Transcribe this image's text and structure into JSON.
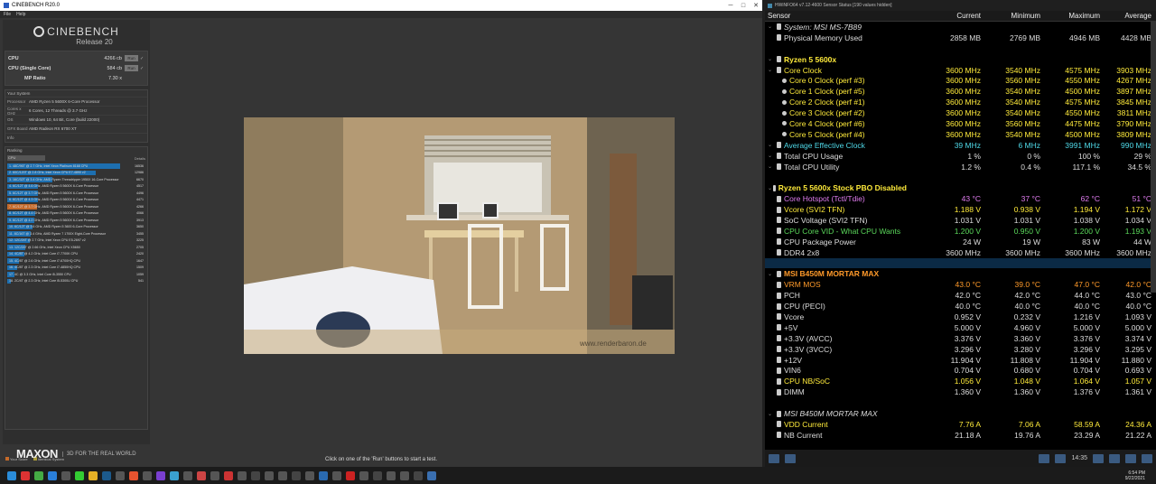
{
  "cinebench": {
    "window_title": "CINEBENCH R20.0",
    "menu": [
      "File",
      "Help"
    ],
    "logo_name": "CINEBENCH",
    "logo_release": "Release 20",
    "scores": [
      {
        "label": "CPU",
        "value": "4266 cb",
        "run": "Run"
      },
      {
        "label": "CPU (Single Core)",
        "value": "584 cb",
        "run": "Run"
      },
      {
        "label": "MP Ratio",
        "value": "7.30 x"
      }
    ],
    "system_title": "Your System",
    "system": [
      {
        "key": "Processor",
        "value": "AMD Ryzen 5 5600X 6-Core Processor"
      },
      {
        "key": "Cores x GHz",
        "value": "6 Cores, 12 Threads @ 3.7 GHz"
      },
      {
        "key": "OS",
        "value": "Windows 10, 64 Bit, Core (build 22000)"
      },
      {
        "key": "GFX Board",
        "value": "AMD Radeon RX 6700 XT"
      },
      {
        "key": "Info",
        "value": ""
      }
    ],
    "ranking_title": "Ranking",
    "ranking_select": "CPU",
    "ranking_details": "Details",
    "ranking": [
      {
        "text": "1. 48C/96T @ 2.7 GHz, Intel Xeon Platinum 8168 CPU",
        "score": "16536",
        "pct": 100,
        "own": false
      },
      {
        "text": "2. 60C/120T @ 2.8 GHz, Intel Xeon CPU E7-4890 v2",
        "score": "12986",
        "pct": 78,
        "own": false
      },
      {
        "text": "3. 16C/32T @ 3.4 GHz, AMD Ryzen Threadripper 1950X 16-Core Processor",
        "score": "6670",
        "pct": 40,
        "own": false
      },
      {
        "text": "4. 6C/12T @ 4.6 GHz, AMD Ryzen 5 5600X 6-Core Processor",
        "score": "4517",
        "pct": 27,
        "own": false
      },
      {
        "text": "5. 6C/12T @ 3.7 GHz, AMD Ryzen 5 5600X 6-Core Processor",
        "score": "4496",
        "pct": 27,
        "own": false
      },
      {
        "text": "6. 6C/12T @ 4.3 GHz, AMD Ryzen 5 5600X 6-Core Processor",
        "score": "4471",
        "pct": 27,
        "own": false
      },
      {
        "text": "7. 6C/12T @ 3.7 GHz, AMD Ryzen 5 5600X 6-Core Processor",
        "score": "4266",
        "pct": 26,
        "own": true
      },
      {
        "text": "8. 6C/12T @ 4.4 GHz, AMD Ryzen 5 5600X 6-Core Processor",
        "score": "4066",
        "pct": 25,
        "own": false
      },
      {
        "text": "9. 6C/12T @ 4.2 GHz, AMD Ryzen 5 5600X 6-Core Processor",
        "score": "3913",
        "pct": 24,
        "own": false
      },
      {
        "text": "10. 6C/12T @ 3.6 GHz, AMD Ryzen 5 3600 6-Core Processor",
        "score": "3650",
        "pct": 22,
        "own": false
      },
      {
        "text": "11. 8C/16T @ 3.4 GHz, AMD Ryzen 7 1700X Eight-Core Processor",
        "score": "3455",
        "pct": 21,
        "own": false
      },
      {
        "text": "12. 12C/24T @ 2.7 GHz, Intel Xeon CPU E5-2697 v2",
        "score": "3225",
        "pct": 20,
        "own": false
      },
      {
        "text": "13. 12C/24T @ 2.66 GHz, Intel Xeon CPU X5650",
        "score": "2705",
        "pct": 16,
        "own": false
      },
      {
        "text": "14. 4C/8T @ 4.2 GHz, Intel Core i7-7700K CPU",
        "score": "2420",
        "pct": 15,
        "own": false
      },
      {
        "text": "15. 4C/8T @ 2.6 GHz, Intel Core i7-6700HQ CPU",
        "score": "1647",
        "pct": 10,
        "own": false
      },
      {
        "text": "16. 4C/8T @ 2.3 GHz, Intel Core i7-4850HQ CPU",
        "score": "1509",
        "pct": 9,
        "own": false
      },
      {
        "text": "17. 4C @ 3.3 GHz, Intel Core i5-3550 CPU",
        "score": "1059",
        "pct": 6,
        "own": false
      },
      {
        "text": "18. 2C/4T @ 2.3 GHz, Intel Core i5-5300U CPU",
        "score": "541",
        "pct": 3,
        "own": false
      }
    ],
    "legend_own": "Your Score",
    "legend_identical": "Identical System",
    "maxon": "MAXON",
    "tagline": "3D FOR THE REAL WORLD",
    "watermark": "www.renderbaron.de",
    "status": "Click on one of the 'Run' buttons to start a test."
  },
  "hwinfo": {
    "window_title": "HWiNFO64 v7.12-4600 Sensor Status [190 values hidden]",
    "columns": [
      "Sensor",
      "Current",
      "Minimum",
      "Maximum",
      "Average"
    ],
    "rows": [
      {
        "t": "group",
        "style": "it",
        "name": "System: MSI MS-7B89"
      },
      {
        "t": "row",
        "c": "wh",
        "name": "Physical Memory Used",
        "v": [
          "2858 MB",
          "2769 MB",
          "4946 MB",
          "4428 MB"
        ]
      },
      {
        "t": "sep"
      },
      {
        "t": "group",
        "style": "",
        "name": "Ryzen 5 5600x"
      },
      {
        "t": "row",
        "c": "ye",
        "ind": 1,
        "name": "Core Clock",
        "v": [
          "3600 MHz",
          "3540 MHz",
          "4575 MHz",
          "3903 MHz"
        ]
      },
      {
        "t": "row",
        "c": "ye",
        "ind": 2,
        "name": "Core 0 Clock (perf #3)",
        "v": [
          "3600 MHz",
          "3560 MHz",
          "4550 MHz",
          "4267 MHz"
        ]
      },
      {
        "t": "row",
        "c": "ye",
        "ind": 2,
        "name": "Core 1 Clock (perf #5)",
        "v": [
          "3600 MHz",
          "3540 MHz",
          "4500 MHz",
          "3897 MHz"
        ]
      },
      {
        "t": "row",
        "c": "ye",
        "ind": 2,
        "name": "Core 2 Clock (perf #1)",
        "v": [
          "3600 MHz",
          "3540 MHz",
          "4575 MHz",
          "3845 MHz"
        ]
      },
      {
        "t": "row",
        "c": "ye",
        "ind": 2,
        "name": "Core 3 Clock (perf #2)",
        "v": [
          "3600 MHz",
          "3540 MHz",
          "4550 MHz",
          "3811 MHz"
        ]
      },
      {
        "t": "row",
        "c": "ye",
        "ind": 2,
        "name": "Core 4 Clock (perf #6)",
        "v": [
          "3600 MHz",
          "3560 MHz",
          "4475 MHz",
          "3790 MHz"
        ]
      },
      {
        "t": "row",
        "c": "ye",
        "ind": 2,
        "name": "Core 5 Clock (perf #4)",
        "v": [
          "3600 MHz",
          "3540 MHz",
          "4500 MHz",
          "3809 MHz"
        ]
      },
      {
        "t": "row",
        "c": "cy",
        "ind": 1,
        "name": "Average Effective Clock",
        "v": [
          "39 MHz",
          "6 MHz",
          "3991 MHz",
          "990 MHz"
        ]
      },
      {
        "t": "row",
        "c": "wh",
        "ind": 1,
        "name": "Total CPU Usage",
        "v": [
          "1 %",
          "0 %",
          "100 %",
          "29 %"
        ]
      },
      {
        "t": "row",
        "c": "wh",
        "ind": 1,
        "name": "Total CPU Utility",
        "v": [
          "1.2 %",
          "0.4 %",
          "117.1 %",
          "34.5 %"
        ]
      },
      {
        "t": "sep"
      },
      {
        "t": "group",
        "style": "",
        "name": "Ryzen 5 5600x Stock PBO Disabled"
      },
      {
        "t": "row",
        "c": "pi",
        "name": "Core Hotspot (Tctl/Tdie)",
        "v": [
          "43 °C",
          "37 °C",
          "62 °C",
          "51 °C"
        ]
      },
      {
        "t": "row",
        "c": "ye",
        "name": "Vcore (SVI2 TFN)",
        "v": [
          "1.188 V",
          "0.938 V",
          "1.194 V",
          "1.172 V"
        ]
      },
      {
        "t": "row",
        "c": "wh",
        "name": "SoC Voltage (SVI2 TFN)",
        "v": [
          "1.031 V",
          "1.031 V",
          "1.038 V",
          "1.034 V"
        ]
      },
      {
        "t": "row",
        "c": "gr",
        "name": "CPU Core VID - What CPU Wants",
        "v": [
          "1.200 V",
          "0.950 V",
          "1.200 V",
          "1.193 V"
        ]
      },
      {
        "t": "row",
        "c": "wh",
        "name": "CPU Package Power",
        "v": [
          "24 W",
          "19 W",
          "83 W",
          "44 W"
        ]
      },
      {
        "t": "row",
        "c": "wh",
        "name": "DDR4 2x8",
        "v": [
          "3600 MHz",
          "3600 MHz",
          "3600 MHz",
          "3600 MHz"
        ]
      },
      {
        "t": "sep",
        "blue": true
      },
      {
        "t": "group",
        "style": "or",
        "name": "MSI B450M MORTAR MAX"
      },
      {
        "t": "row",
        "c": "or",
        "name": "VRM MOS",
        "v": [
          "43.0 °C",
          "39.0 °C",
          "47.0 °C",
          "42.0 °C"
        ]
      },
      {
        "t": "row",
        "c": "wh",
        "name": "PCH",
        "v": [
          "42.0 °C",
          "42.0 °C",
          "44.0 °C",
          "43.0 °C"
        ]
      },
      {
        "t": "row",
        "c": "wh",
        "name": "CPU (PECI)",
        "v": [
          "40.0 °C",
          "40.0 °C",
          "40.0 °C",
          "40.0 °C"
        ]
      },
      {
        "t": "row",
        "c": "wh",
        "name": "Vcore",
        "v": [
          "0.952 V",
          "0.232 V",
          "1.216 V",
          "1.093 V"
        ]
      },
      {
        "t": "row",
        "c": "wh",
        "name": "+5V",
        "v": [
          "5.000 V",
          "4.960 V",
          "5.000 V",
          "5.000 V"
        ]
      },
      {
        "t": "row",
        "c": "wh",
        "name": "+3.3V (AVCC)",
        "v": [
          "3.376 V",
          "3.360 V",
          "3.376 V",
          "3.374 V"
        ]
      },
      {
        "t": "row",
        "c": "wh",
        "name": "+3.3V (3VCC)",
        "v": [
          "3.296 V",
          "3.280 V",
          "3.296 V",
          "3.295 V"
        ]
      },
      {
        "t": "row",
        "c": "wh",
        "name": "+12V",
        "v": [
          "11.904 V",
          "11.808 V",
          "11.904 V",
          "11.880 V"
        ]
      },
      {
        "t": "row",
        "c": "wh",
        "name": "VIN6",
        "v": [
          "0.704 V",
          "0.680 V",
          "0.704 V",
          "0.693 V"
        ]
      },
      {
        "t": "row",
        "c": "ye",
        "name": "CPU NB/SoC",
        "v": [
          "1.056 V",
          "1.048 V",
          "1.064 V",
          "1.057 V"
        ]
      },
      {
        "t": "row",
        "c": "wh",
        "name": "DIMM",
        "v": [
          "1.360 V",
          "1.360 V",
          "1.376 V",
          "1.361 V"
        ]
      },
      {
        "t": "sep"
      },
      {
        "t": "group",
        "style": "it",
        "name": "MSI B450M MORTAR MAX"
      },
      {
        "t": "row",
        "c": "ye",
        "name": "VDD Current",
        "v": [
          "7.76 A",
          "7.06 A",
          "58.59 A",
          "24.36 A"
        ]
      },
      {
        "t": "row",
        "c": "wh",
        "name": "NB Current",
        "v": [
          "21.18 A",
          "19.76 A",
          "23.29 A",
          "21.22 A"
        ]
      }
    ],
    "footer_clock": "14:35"
  },
  "taskbar": {
    "time": "6:54 PM",
    "date": "9/22/2021"
  },
  "colors": {
    "cinebench_bg": "#353535",
    "rank_bar": "#1d6fb0",
    "own_bar": "#c56a2a",
    "hw_yellow": "#ffeb3b",
    "hw_orange": "#ff9a2a",
    "hw_cyan": "#4fd9e8",
    "hw_green": "#5bd95b",
    "hw_pink": "#e07cf0"
  }
}
